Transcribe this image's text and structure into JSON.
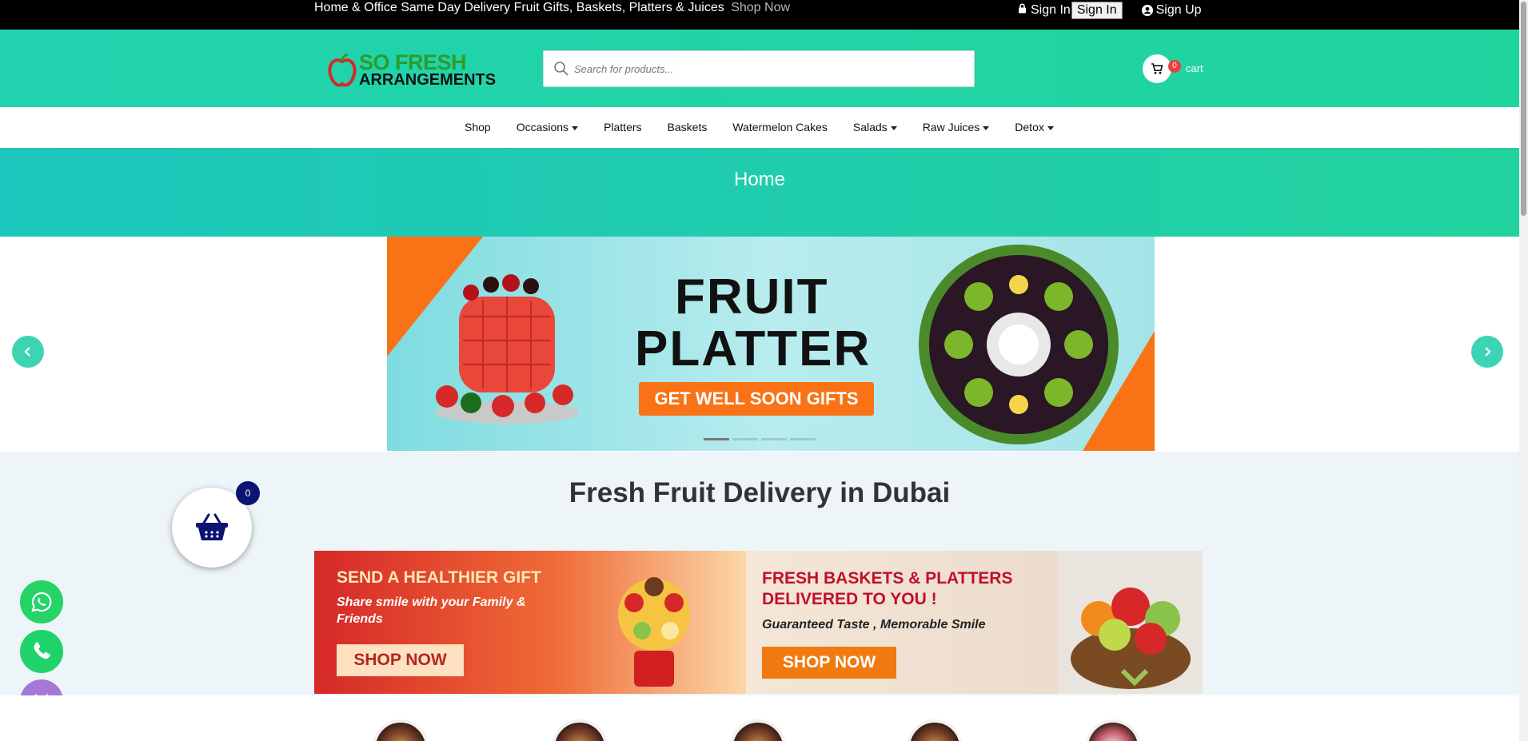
{
  "topbar": {
    "promo": "Home & Office Same Day Delivery Fruit Gifts, Baskets, Platters & Juices",
    "promo_link": "Shop Now",
    "signin_text": "Sign In",
    "signin_button": "Sign In",
    "signup": "Sign Up"
  },
  "header": {
    "logo_line1": "SO FRESH",
    "logo_line2": "ARRANGEMENTS",
    "search_placeholder": "Search for products...",
    "cart_count": "0",
    "cart_label": "cart"
  },
  "nav": {
    "items": [
      {
        "label": "Shop",
        "dropdown": false
      },
      {
        "label": "Occasions",
        "dropdown": true
      },
      {
        "label": "Platters",
        "dropdown": false
      },
      {
        "label": "Baskets",
        "dropdown": false
      },
      {
        "label": "Watermelon Cakes",
        "dropdown": false
      },
      {
        "label": "Salads",
        "dropdown": true
      },
      {
        "label": "Raw Juices",
        "dropdown": true
      },
      {
        "label": "Detox",
        "dropdown": true
      }
    ]
  },
  "hero": {
    "title": "Home"
  },
  "slider": {
    "line1": "FRUIT",
    "line2": "PLATTER",
    "cta": "GET WELL SOON GIFTS",
    "slide_count": 4,
    "active_slide": 1
  },
  "intro": {
    "heading": "Fresh Fruit Delivery in Dubai"
  },
  "promo_banner": {
    "left": {
      "headline": "SEND A HEALTHIER GIFT",
      "sub": "Share smile with your Family & Friends",
      "button": "SHOP NOW"
    },
    "right": {
      "headline": "FRESH BASKETS & PLATTERS DELIVERED TO YOU !",
      "sub": "Guaranteed Taste , Memorable Smile",
      "button": "SHOP NOW"
    }
  },
  "floating_cart": {
    "count": "0"
  },
  "colors": {
    "brand_teal": "#22d3b0",
    "accent_orange": "#f97316",
    "cart_badge": "#ef3d3d",
    "whatsapp": "#25d366",
    "close_fab": "#a678d6"
  },
  "icons": [
    "lock-icon",
    "user-icon",
    "search-icon",
    "cart-icon",
    "chevron-left-icon",
    "chevron-right-icon",
    "basket-icon",
    "whatsapp-icon",
    "phone-icon",
    "close-icon"
  ]
}
